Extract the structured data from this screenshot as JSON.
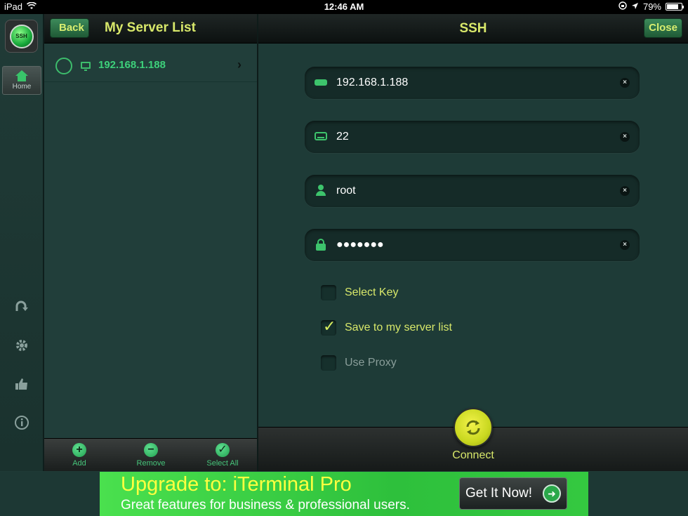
{
  "statusbar": {
    "device": "iPad",
    "time": "12:46 AM",
    "battery_text": "79%",
    "battery_level": 0.79
  },
  "rail": {
    "logo_text": "SSH",
    "home_label": "Home"
  },
  "server_list": {
    "back_label": "Back",
    "title": "My Server List",
    "servers": [
      {
        "address": "192.168.1.188"
      }
    ],
    "toolbar": {
      "add_label": "Add",
      "remove_label": "Remove",
      "select_all_label": "Select All"
    }
  },
  "main": {
    "title": "SSH",
    "close_label": "Close",
    "fields": {
      "host": "192.168.1.188",
      "port": "22",
      "username": "root",
      "password": "●●●●●●●"
    },
    "options": {
      "select_key": {
        "label": "Select Key",
        "checked": false
      },
      "save_to_list": {
        "label": "Save to my server list",
        "checked": true
      },
      "use_proxy": {
        "label": "Use Proxy",
        "checked": false
      }
    },
    "connect_label": "Connect"
  },
  "ad": {
    "line1": "Upgrade to:  iTerminal Pro",
    "line2": "Great features for business & professional users.",
    "cta_label": "Get It Now!"
  },
  "colors": {
    "accent_green": "#3dc46c",
    "label_yellow": "#d8e86a",
    "disabled_label": "#8a9e9a",
    "background": "#1f3a36"
  }
}
